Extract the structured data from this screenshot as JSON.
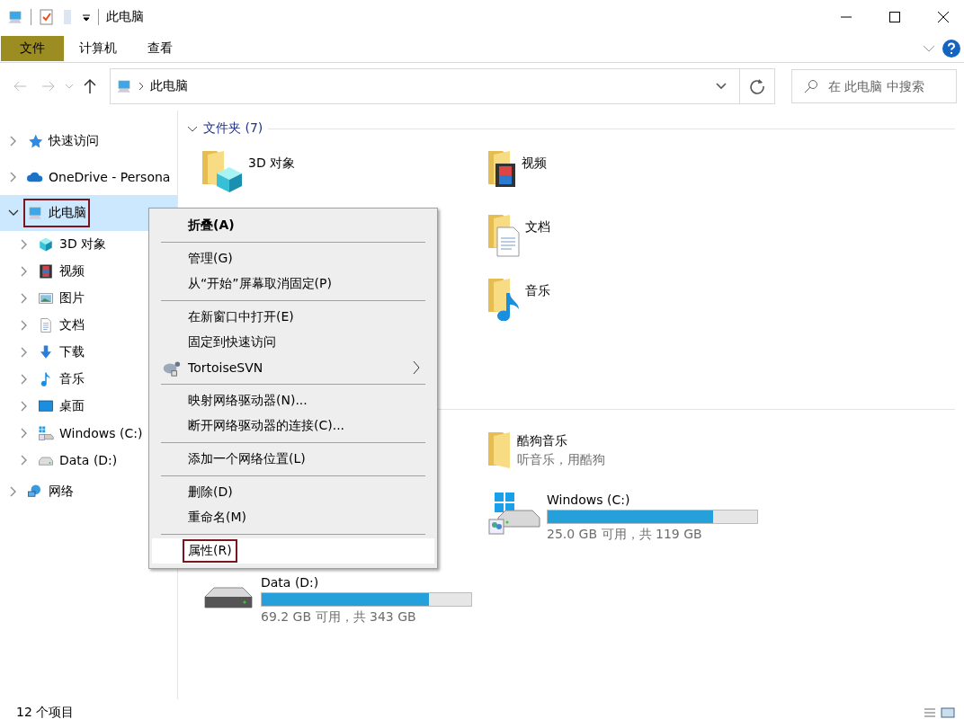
{
  "window": {
    "title": "此电脑"
  },
  "ribbon_tabs": [
    {
      "label": "文件",
      "selected": true
    },
    {
      "label": "计算机",
      "selected": false
    },
    {
      "label": "查看",
      "selected": false
    }
  ],
  "address": {
    "path": "此电脑"
  },
  "search": {
    "placeholder": "在 此电脑 中搜索"
  },
  "nav": [
    {
      "label": "快速访问",
      "kind": "star",
      "expanded": false,
      "selected": false,
      "highlighted": false
    },
    {
      "label": "OneDrive - Persona",
      "kind": "cloud",
      "expanded": false,
      "selected": false,
      "highlighted": false
    },
    {
      "label": "此电脑",
      "kind": "pc",
      "expanded": true,
      "selected": true,
      "highlighted": true,
      "children": [
        {
          "label": "3D 对象",
          "kind": "cube",
          "expanded": false,
          "selected": false,
          "highlighted": false
        },
        {
          "label": "视频",
          "kind": "film",
          "expanded": false,
          "selected": false,
          "highlighted": false
        },
        {
          "label": "图片",
          "kind": "image",
          "expanded": false,
          "selected": false,
          "highlighted": false
        },
        {
          "label": "文档",
          "kind": "doc",
          "expanded": false,
          "selected": false,
          "highlighted": false
        },
        {
          "label": "下载",
          "kind": "download",
          "expanded": false,
          "selected": false,
          "highlighted": false
        },
        {
          "label": "音乐",
          "kind": "music",
          "expanded": false,
          "selected": false,
          "highlighted": false
        },
        {
          "label": "桌面",
          "kind": "desktop",
          "expanded": false,
          "selected": false,
          "highlighted": false
        },
        {
          "label": "Windows (C:)",
          "kind": "windrive",
          "expanded": false,
          "selected": false,
          "highlighted": false
        },
        {
          "label": "Data (D:)",
          "kind": "drive",
          "expanded": false,
          "selected": false,
          "highlighted": false
        }
      ]
    },
    {
      "label": "网络",
      "kind": "network",
      "expanded": false,
      "selected": false,
      "highlighted": false
    }
  ],
  "folders": {
    "title": "文件夹 (7)",
    "expanded": true,
    "items": [
      {
        "name": "3D 对象",
        "kind": "cube"
      },
      {
        "name": "视频",
        "kind": "film"
      },
      {
        "name": "文档",
        "kind": "doc"
      },
      {
        "name": "音乐",
        "kind": "music"
      }
    ]
  },
  "devices": [
    {
      "name": "酷狗音乐",
      "kind": "folder",
      "detail": "听音乐，用酷狗"
    },
    {
      "name": "Windows (C:)",
      "kind": "windrive",
      "level": 0.79,
      "detail": "25.0 GB 可用，共 119 GB"
    },
    {
      "name": "Data (D:)",
      "kind": "drive",
      "level": 0.8,
      "detail": "69.2 GB 可用，共 343 GB"
    }
  ],
  "context_menu": [
    [
      {
        "label": "折叠(A)",
        "kind": "default",
        "selected": false,
        "highlighted": false
      }
    ],
    [
      {
        "label": "管理(G)",
        "kind": "plain",
        "selected": false,
        "highlighted": false
      },
      {
        "label": "从“开始”屏幕取消固定(P)",
        "kind": "plain",
        "selected": false,
        "highlighted": false
      }
    ],
    [
      {
        "label": "在新窗口中打开(E)",
        "kind": "plain",
        "selected": false,
        "highlighted": false
      },
      {
        "label": "固定到快速访问",
        "kind": "plain",
        "selected": false,
        "highlighted": false
      },
      {
        "label": "TortoiseSVN",
        "kind": "submenu",
        "selected": false,
        "highlighted": false
      }
    ],
    [
      {
        "label": "映射网络驱动器(N)...",
        "kind": "plain",
        "selected": false,
        "highlighted": false
      },
      {
        "label": "断开网络驱动器的连接(C)...",
        "kind": "plain",
        "selected": false,
        "highlighted": false
      }
    ],
    [
      {
        "label": "添加一个网络位置(L)",
        "kind": "plain",
        "selected": false,
        "highlighted": false
      }
    ],
    [
      {
        "label": "删除(D)",
        "kind": "plain",
        "selected": false,
        "highlighted": false
      },
      {
        "label": "重命名(M)",
        "kind": "plain",
        "selected": false,
        "highlighted": false
      }
    ],
    [
      {
        "label": "属性(R)",
        "kind": "plain",
        "selected": true,
        "highlighted": true
      }
    ]
  ],
  "status_bar": {
    "count": "12 个项目"
  }
}
